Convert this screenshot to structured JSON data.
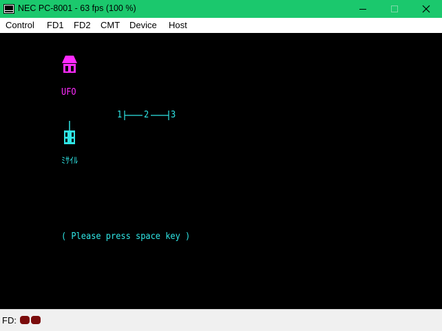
{
  "window": {
    "title": "NEC PC-8001 - 63 fps (100 %)",
    "titlebar_color": "#1bc86d",
    "controls": [
      "minimize-icon",
      "maximize-icon",
      "close-icon"
    ]
  },
  "menubar": {
    "items": [
      {
        "label": "Control"
      },
      {
        "label": "FD1"
      },
      {
        "label": "FD2"
      },
      {
        "label": "CMT"
      },
      {
        "label": "Device"
      },
      {
        "label": "Host"
      }
    ]
  },
  "screen": {
    "background": "#000000",
    "ufo_label": "UFO",
    "ufo_color": "#ff2bff",
    "missile_label": "ﾐｻｲﾙ",
    "text_color": "#2fe6e6",
    "scale": {
      "mark_1": "1",
      "mark_2": "2",
      "mark_3": "3"
    },
    "prompt": "( Please press space key )"
  },
  "statusbar": {
    "fd_label": "FD:",
    "drive_leds": [
      {
        "drive": 1,
        "color": "#7a0b0b"
      },
      {
        "drive": 2,
        "color": "#7a0b0b"
      }
    ]
  }
}
